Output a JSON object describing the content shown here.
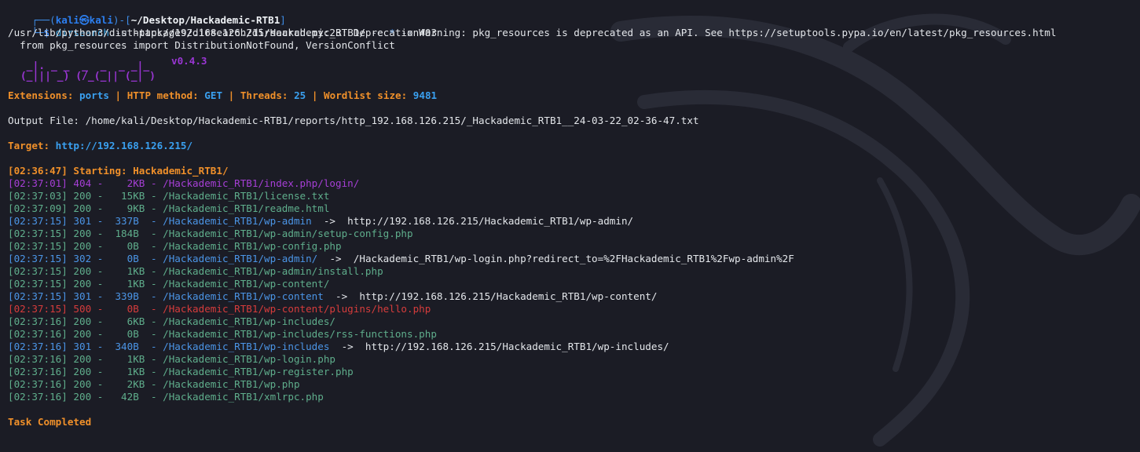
{
  "prompt": {
    "user": "kali",
    "host": "kali",
    "path": "~/Desktop/Hackademic-RTB1",
    "command": "dirsearch",
    "flag_u": "-u",
    "url": "http://192.168.126.215/Hackademic_RTB1/",
    "flag_e": "-e",
    "star": "*",
    "flag_x": "-x",
    "code": "403"
  },
  "warning": {
    "line1": "/usr/lib/python3/dist-packages/dirsearch/dirsearch.py:23: DeprecationWarning: pkg_resources is deprecated as an API. See https://setuptools.pypa.io/en/latest/pkg_resources.html",
    "line2": "  from pkg_resources import DistributionNotFound, VersionConflict"
  },
  "logo": {
    "row1": "  _|. _ _  _  _  _ _|_",
    "row2": " (_||| _) (/_(_|| (_| )",
    "version": "v0.4.3"
  },
  "info": {
    "extensions_label": "Extensions:",
    "extensions_value": "ports",
    "method_label": "HTTP method:",
    "method_value": "GET",
    "threads_label": "Threads:",
    "threads_value": "25",
    "wordlist_label": "Wordlist size:",
    "wordlist_value": "9481",
    "sep": "|"
  },
  "output_file": "Output File: /home/kali/Desktop/Hackademic-RTB1/reports/http_192.168.126.215/_Hackademic_RTB1__24-03-22_02-36-47.txt",
  "target": {
    "label": "Target:",
    "value": "http://192.168.126.215/"
  },
  "starting": "[02:36:47] Starting: Hackademic_RTB1/",
  "results": [
    {
      "text": "[02:37:01] 404 -    2KB - /Hackademic_RTB1/index.php/login/",
      "redirect": "",
      "color": "#a63fd6"
    },
    {
      "text": "[02:37:03] 200 -   15KB - /Hackademic_RTB1/license.txt",
      "redirect": "",
      "color": "#5fae8c"
    },
    {
      "text": "[02:37:09] 200 -    9KB - /Hackademic_RTB1/readme.html",
      "redirect": "",
      "color": "#5fae8c"
    },
    {
      "text": "[02:37:15] 301 -  337B  - /Hackademic_RTB1/wp-admin",
      "redirect": "  ->  http://192.168.126.215/Hackademic_RTB1/wp-admin/",
      "color": "#4b95e6"
    },
    {
      "text": "[02:37:15] 200 -  184B  - /Hackademic_RTB1/wp-admin/setup-config.php",
      "redirect": "",
      "color": "#5fae8c"
    },
    {
      "text": "[02:37:15] 200 -    0B  - /Hackademic_RTB1/wp-config.php",
      "redirect": "",
      "color": "#5fae8c"
    },
    {
      "text": "[02:37:15] 302 -    0B  - /Hackademic_RTB1/wp-admin/",
      "redirect": "  ->  /Hackademic_RTB1/wp-login.php?redirect_to=%2FHackademic_RTB1%2Fwp-admin%2F",
      "color": "#4b95e6"
    },
    {
      "text": "[02:37:15] 200 -    1KB - /Hackademic_RTB1/wp-admin/install.php",
      "redirect": "",
      "color": "#5fae8c"
    },
    {
      "text": "[02:37:15] 200 -    1KB - /Hackademic_RTB1/wp-content/",
      "redirect": "",
      "color": "#5fae8c"
    },
    {
      "text": "[02:37:15] 301 -  339B  - /Hackademic_RTB1/wp-content",
      "redirect": "  ->  http://192.168.126.215/Hackademic_RTB1/wp-content/",
      "color": "#4b95e6"
    },
    {
      "text": "[02:37:15] 500 -    0B  - /Hackademic_RTB1/wp-content/plugins/hello.php",
      "redirect": "",
      "color": "#d63c3c"
    },
    {
      "text": "[02:37:16] 200 -    6KB - /Hackademic_RTB1/wp-includes/",
      "redirect": "",
      "color": "#5fae8c"
    },
    {
      "text": "[02:37:16] 200 -    0B  - /Hackademic_RTB1/wp-includes/rss-functions.php",
      "redirect": "",
      "color": "#5fae8c"
    },
    {
      "text": "[02:37:16] 301 -  340B  - /Hackademic_RTB1/wp-includes",
      "redirect": "  ->  http://192.168.126.215/Hackademic_RTB1/wp-includes/",
      "color": "#4b95e6"
    },
    {
      "text": "[02:37:16] 200 -    1KB - /Hackademic_RTB1/wp-login.php",
      "redirect": "",
      "color": "#5fae8c"
    },
    {
      "text": "[02:37:16] 200 -    1KB - /Hackademic_RTB1/wp-register.php",
      "redirect": "",
      "color": "#5fae8c"
    },
    {
      "text": "[02:37:16] 200 -    2KB - /Hackademic_RTB1/wp.php",
      "redirect": "",
      "color": "#5fae8c"
    },
    {
      "text": "[02:37:16] 200 -   42B  - /Hackademic_RTB1/xmlrpc.php",
      "redirect": "",
      "color": "#5fae8c"
    }
  ],
  "completed": "Task Completed"
}
